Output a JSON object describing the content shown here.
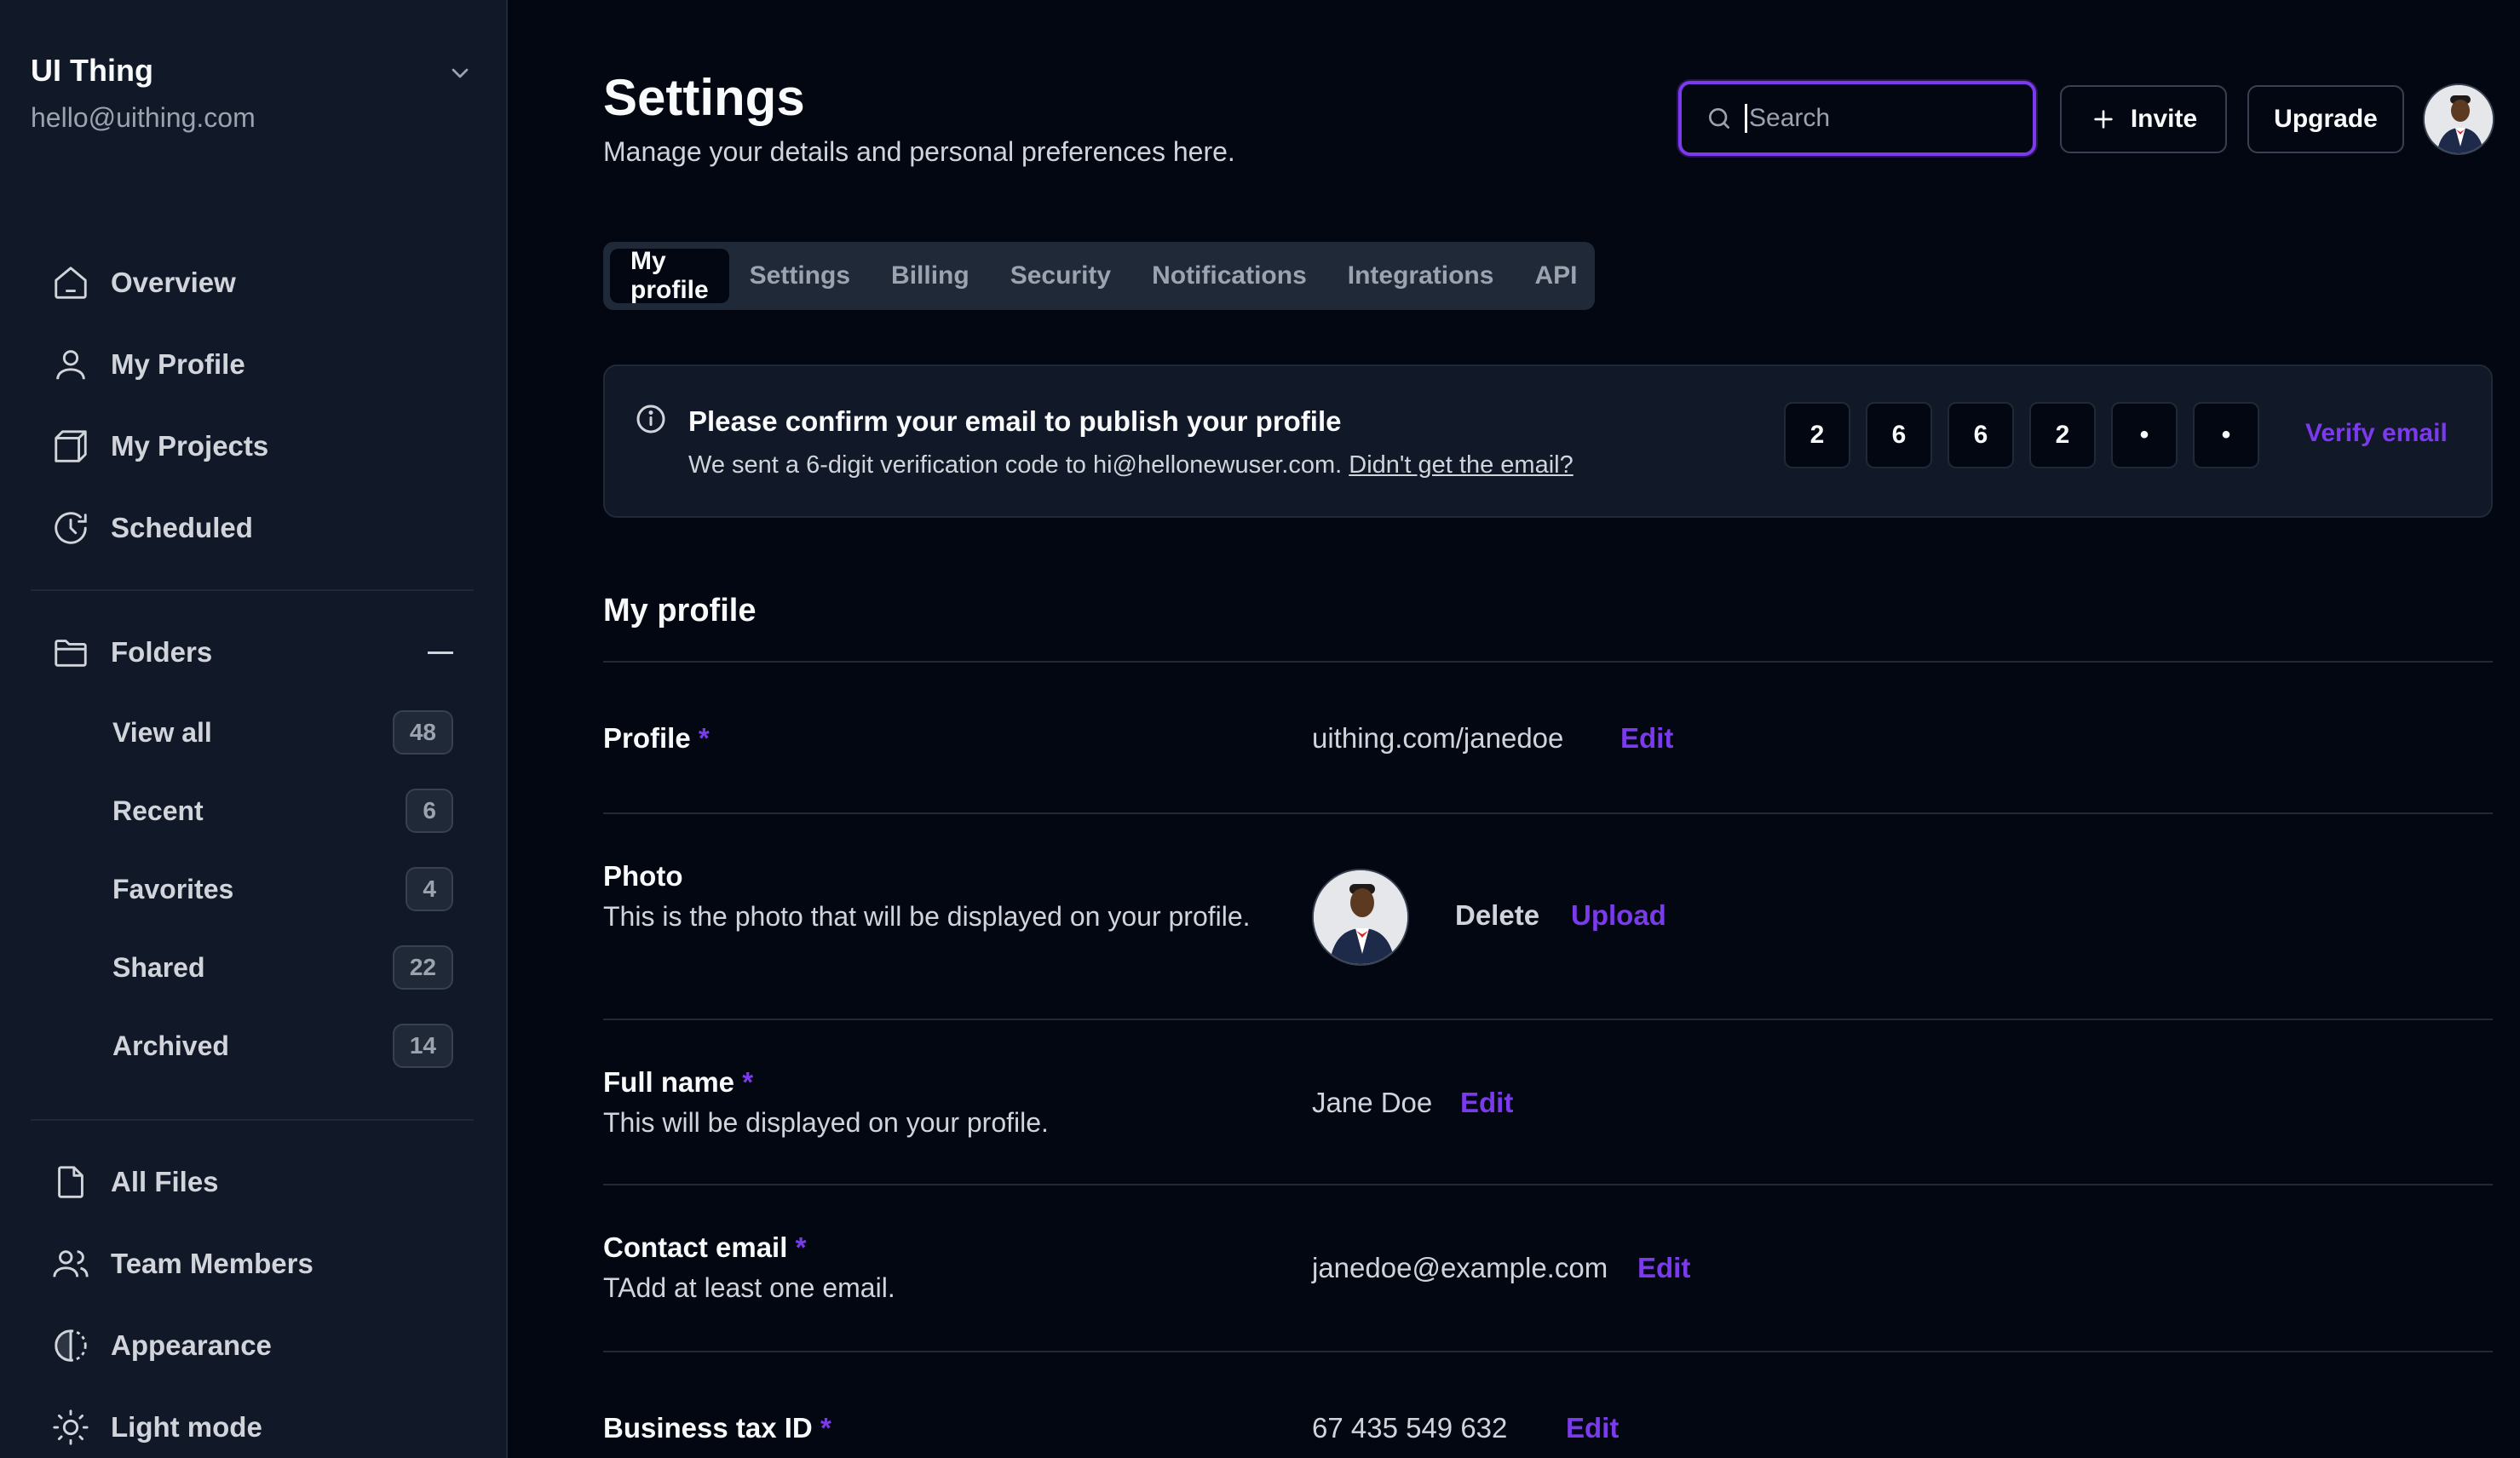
{
  "sidebar": {
    "brand_name": "UI Thing",
    "brand_email": "hello@uithing.com",
    "nav": [
      {
        "label": "Overview",
        "icon": "home-icon"
      },
      {
        "label": "My Profile",
        "icon": "user-icon"
      },
      {
        "label": "My Projects",
        "icon": "box-icon"
      },
      {
        "label": "Scheduled",
        "icon": "clock-icon"
      }
    ],
    "folders_label": "Folders",
    "folders": [
      {
        "label": "View all",
        "count": "48"
      },
      {
        "label": "Recent",
        "count": "6"
      },
      {
        "label": "Favorites",
        "count": "4"
      },
      {
        "label": "Shared",
        "count": "22"
      },
      {
        "label": "Archived",
        "count": "14"
      }
    ],
    "bottom_nav": [
      {
        "label": "All Files",
        "icon": "file-icon"
      },
      {
        "label": "Team Members",
        "icon": "users-icon"
      },
      {
        "label": "Appearance",
        "icon": "contrast-icon"
      },
      {
        "label": "Light mode",
        "icon": "sun-icon"
      }
    ]
  },
  "header": {
    "title": "Settings",
    "subtitle": "Manage your details and personal preferences here.",
    "search_placeholder": "Search",
    "invite_label": "Invite",
    "upgrade_label": "Upgrade"
  },
  "tabs": [
    "My profile",
    "Settings",
    "Billing",
    "Security",
    "Notifications",
    "Integrations",
    "API"
  ],
  "active_tab": "My profile",
  "alert": {
    "title": "Please confirm your email to publish your profile",
    "text": "We sent a 6-digit verification code to hi@hellonewuser.com.",
    "link": "Didn't get the email?",
    "otp": [
      "2",
      "6",
      "6",
      "2",
      "•",
      "•"
    ],
    "verify_label": "Verify email"
  },
  "profile": {
    "section_title": "My profile",
    "required_mark": "*",
    "profile_label": "Profile",
    "profile_value": "uithing.com/janedoe",
    "photo_label": "Photo",
    "photo_desc": "This is the photo that will be displayed on your profile.",
    "delete_label": "Delete",
    "upload_label": "Upload",
    "fullname_label": "Full name",
    "fullname_desc": "This will be displayed on your profile.",
    "fullname_value": "Jane Doe",
    "email_label": "Contact email",
    "email_desc": "TAdd at least one email.",
    "email_value": "janedoe@example.com",
    "tax_label": "Business tax ID",
    "tax_value": "67 435 549 632",
    "edit_label": "Edit"
  },
  "colors": {
    "accent": "#7c3aed",
    "background": "#030712",
    "sidebar": "#111827"
  }
}
